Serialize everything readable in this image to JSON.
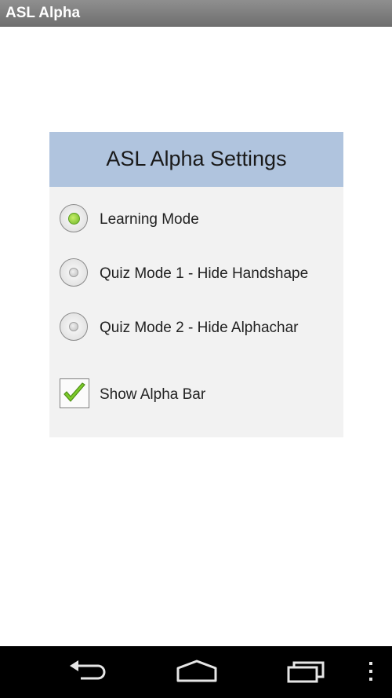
{
  "app": {
    "title": "ASL Alpha"
  },
  "settings": {
    "title": "ASL Alpha Settings",
    "modes": [
      {
        "label": "Learning Mode",
        "selected": true
      },
      {
        "label": "Quiz Mode 1 - Hide Handshape",
        "selected": false
      },
      {
        "label": "Quiz Mode 2 - Hide Alphachar",
        "selected": false
      }
    ],
    "show_alpha_bar": {
      "label": "Show Alpha Bar",
      "checked": true
    }
  },
  "navbar": {
    "buttons": [
      "back-icon",
      "home-icon",
      "recent-apps-icon",
      "menu-icon"
    ]
  },
  "colors": {
    "header_bg": "#b0c4de",
    "panel_bg": "#f2f2f2",
    "accent_green": "#6cb526",
    "titlebar": "#7a7a7a"
  }
}
